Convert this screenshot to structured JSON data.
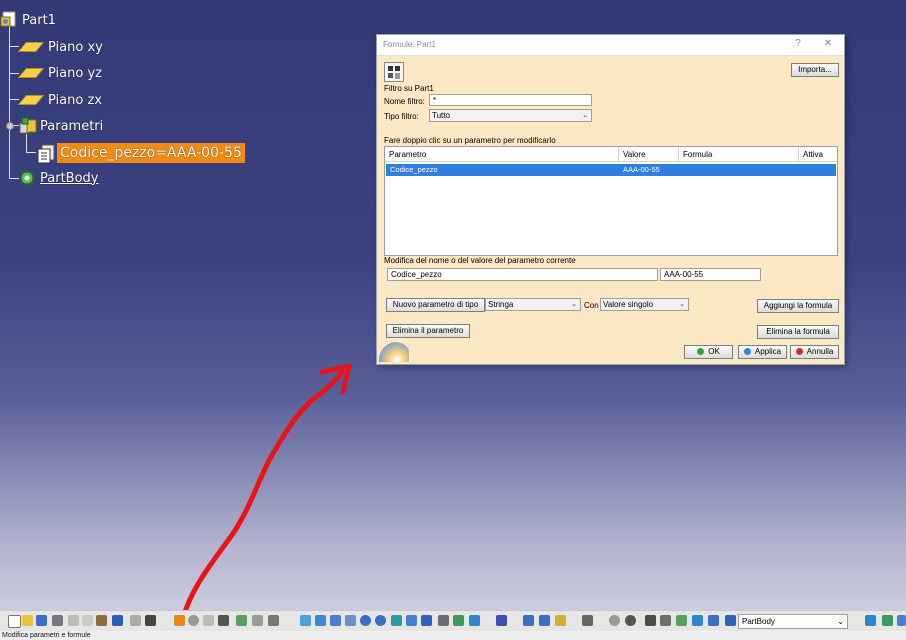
{
  "tree": {
    "root": "Part1",
    "planes": [
      "Piano xy",
      "Piano yz",
      "Piano zx"
    ],
    "parameters_set": "Parametri",
    "parameter_item": "Codice_pezzo=AAA-00-55",
    "body": "PartBody"
  },
  "dialog": {
    "title": "Formule: Part1",
    "help": "?",
    "close": "✕",
    "import_button": "Importa...",
    "filter_title": "Filtro su Part1",
    "filter_name_label": "Nome filtro:",
    "filter_name_value": "*",
    "filter_type_label": "Tipo filtro:",
    "filter_type_value": "Tutto",
    "table_caption": "Fare doppio clic su un parametro per modificarlo",
    "columns": [
      "Parametro",
      "Valore",
      "Formula",
      "Attiva"
    ],
    "rows": [
      {
        "parametro": "Codice_pezzo",
        "valore": "AAA-00-55",
        "formula": "",
        "attiva": ""
      }
    ],
    "edit_caption": "Modifica del nome o del valore del parametro corrente",
    "edit_name": "Codice_pezzo",
    "edit_value": "AAA-00-55",
    "new_param_button": "Nuovo parametro di tipo",
    "type_value": "Stringa",
    "with_label": "Con",
    "with_value": "Valore singolo",
    "add_formula_button": "Aggiungi la formula",
    "delete_param_button": "Elimina il parametro",
    "delete_formula_button": "Elimina la formula",
    "ok_button": "OK",
    "apply_button": "Applica",
    "cancel_button": "Annulla"
  },
  "toolbar": {
    "body_select": "PartBody"
  },
  "status_text": "Modifica parametri e formule",
  "colors": {
    "accent_selected": "#f28b12",
    "row_selected": "#2f7fe0",
    "annotation_arrow": "#e8141b"
  }
}
